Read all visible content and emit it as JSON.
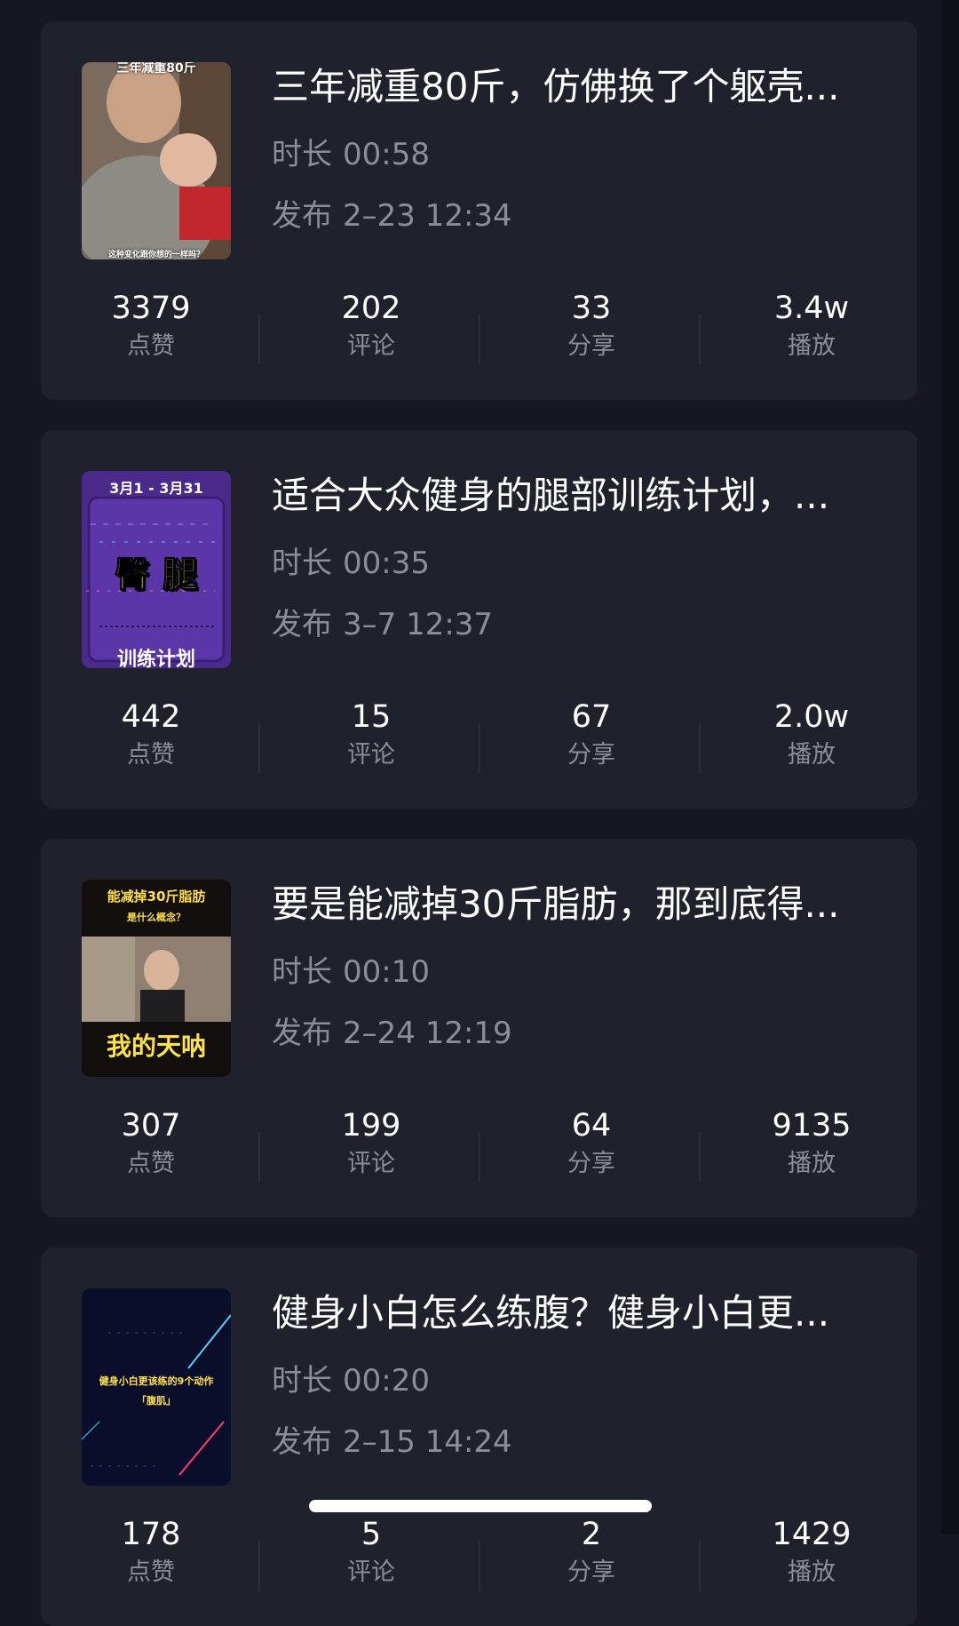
{
  "videos": [
    {
      "title": "三年减重80斤，仿佛换了个躯壳...",
      "duration_label": "时长",
      "duration": "00:58",
      "published_label": "发布",
      "published": "2–23 12:34",
      "thumb": {
        "top": "三年减重80斤",
        "bottom": "这种变化跟你想的一样吗？"
      },
      "stats": [
        {
          "value": "3379",
          "label": "点赞"
        },
        {
          "value": "202",
          "label": "评论"
        },
        {
          "value": "33",
          "label": "分享"
        },
        {
          "value": "3.4w",
          "label": "播放"
        }
      ]
    },
    {
      "title": "适合大众健身的腿部训练计划，...",
      "duration_label": "时长",
      "duration": "00:35",
      "published_label": "发布",
      "published": "3–7 12:37",
      "thumb": {
        "top": "3月1 - 3月31",
        "main": "臀 腿",
        "bottom": "训练计划"
      },
      "stats": [
        {
          "value": "442",
          "label": "点赞"
        },
        {
          "value": "15",
          "label": "评论"
        },
        {
          "value": "67",
          "label": "分享"
        },
        {
          "value": "2.0w",
          "label": "播放"
        }
      ]
    },
    {
      "title": "要是能减掉30斤脂肪，那到底得...",
      "duration_label": "时长",
      "duration": "00:10",
      "published_label": "发布",
      "published": "2–24 12:19",
      "thumb": {
        "top": "能减掉30斤脂肪",
        "sub": "是什么概念？",
        "bottom": "我的天呐"
      },
      "stats": [
        {
          "value": "307",
          "label": "点赞"
        },
        {
          "value": "199",
          "label": "评论"
        },
        {
          "value": "64",
          "label": "分享"
        },
        {
          "value": "9135",
          "label": "播放"
        }
      ]
    },
    {
      "title": "健身小白怎么练腹？健身小白更...",
      "duration_label": "时长",
      "duration": "00:20",
      "published_label": "发布",
      "published": "2–15 14:24",
      "thumb": {
        "main": "健身小白更该练的9个动作",
        "sub": "「腹肌」"
      },
      "stats": [
        {
          "value": "178",
          "label": "点赞"
        },
        {
          "value": "5",
          "label": "评论"
        },
        {
          "value": "2",
          "label": "分享"
        },
        {
          "value": "1429",
          "label": "播放"
        }
      ]
    }
  ]
}
